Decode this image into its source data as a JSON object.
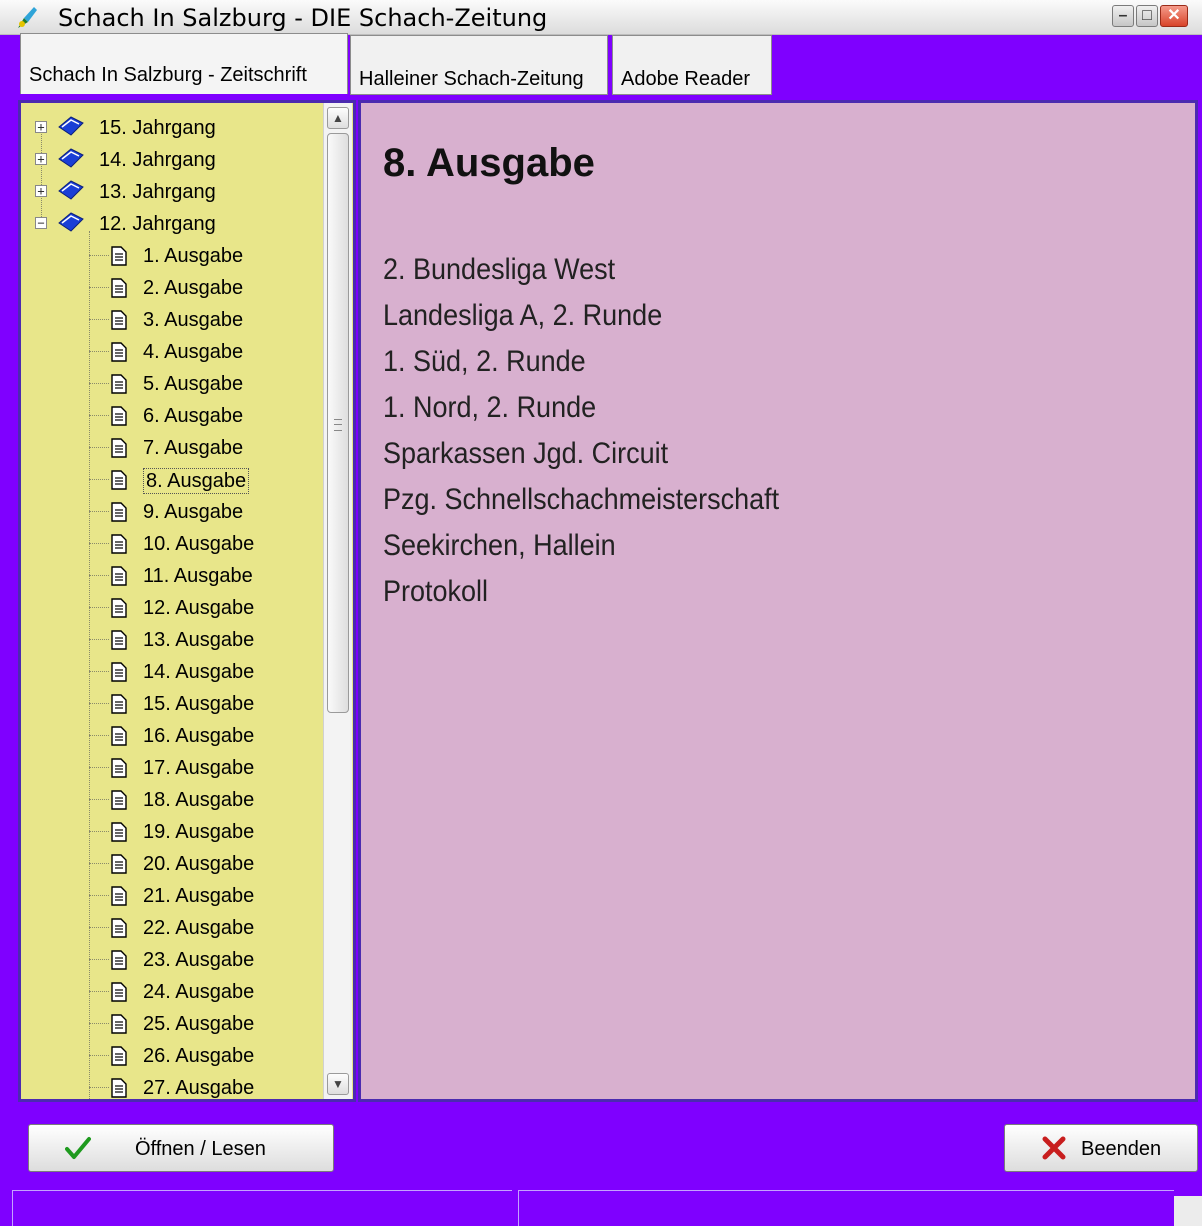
{
  "window": {
    "title": "Schach In Salzburg - DIE Schach-Zeitung",
    "minimize_glyph": "–",
    "maximize_glyph": "□",
    "close_glyph": "✕"
  },
  "tabs": [
    {
      "label": "Schach In Salzburg - Zeitschrift",
      "active": true
    },
    {
      "label": "Halleiner Schach-Zeitung",
      "active": false
    },
    {
      "label": "Adobe Reader",
      "active": false
    }
  ],
  "tree": {
    "years": [
      {
        "label": "15. Jahrgang",
        "expander": "+"
      },
      {
        "label": "14. Jahrgang",
        "expander": "+"
      },
      {
        "label": "13. Jahrgang",
        "expander": "+"
      },
      {
        "label": "12. Jahrgang",
        "expander": "−"
      }
    ],
    "issues": [
      "1. Ausgabe",
      "2. Ausgabe",
      "3. Ausgabe",
      "4. Ausgabe",
      "5. Ausgabe",
      "6. Ausgabe",
      "7. Ausgabe",
      "8. Ausgabe",
      "9. Ausgabe",
      "10. Ausgabe",
      "11. Ausgabe",
      "12. Ausgabe",
      "13. Ausgabe",
      "14. Ausgabe",
      "15. Ausgabe",
      "16. Ausgabe",
      "17. Ausgabe",
      "18. Ausgabe",
      "19. Ausgabe",
      "20. Ausgabe",
      "21. Ausgabe",
      "22. Ausgabe",
      "23. Ausgabe",
      "24. Ausgabe",
      "25. Ausgabe",
      "26. Ausgabe",
      "27. Ausgabe"
    ],
    "selected_issue": "8. Ausgabe",
    "book_icon": "book-icon",
    "issue_icon": "document-icon"
  },
  "content": {
    "heading": "8. Ausgabe",
    "lines": [
      "2. Bundesliga West",
      "Landesliga A, 2. Runde",
      "1. Süd, 2. Runde",
      "1. Nord, 2. Runde",
      "Sparkassen Jgd. Circuit",
      "Pzg. Schnellschachmeisterschaft",
      "Seekirchen, Hallein",
      "Protokoll"
    ]
  },
  "buttons": {
    "open_label": "Öffnen / Lesen",
    "close_label": "Beenden"
  },
  "colors": {
    "frame": "#7f00ff",
    "tree_bg": "#e8e68a",
    "content_bg": "#d8b0cf"
  }
}
